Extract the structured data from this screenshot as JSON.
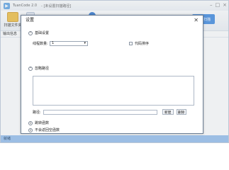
{
  "app": {
    "title": "TuanCode 2.0",
    "subtitle": "- [未设置扫描路径]"
  },
  "toolbar": {
    "scan_dir_label": "扫描文件夹",
    "dir_label": "扫",
    "start_label": "开始扫描"
  },
  "output": {
    "header_label": "输出信息"
  },
  "status": {
    "text": "就绪"
  },
  "dialog": {
    "title": "设置",
    "close_symbol": "✕",
    "sections": {
      "basic": "基础设置",
      "ignore": "忽略路径",
      "skip": "跳转函数",
      "nonempty": "不会返回空函数"
    },
    "basic": {
      "threads_label": "线程数量:",
      "threads_value": "1",
      "code_format_label": "代码排序"
    },
    "ignore": {
      "path_label": "路径:",
      "path_value": "",
      "new_button": "新建",
      "delete_button": "删除"
    },
    "icons": {
      "collapse": "^",
      "expand": "v"
    }
  }
}
